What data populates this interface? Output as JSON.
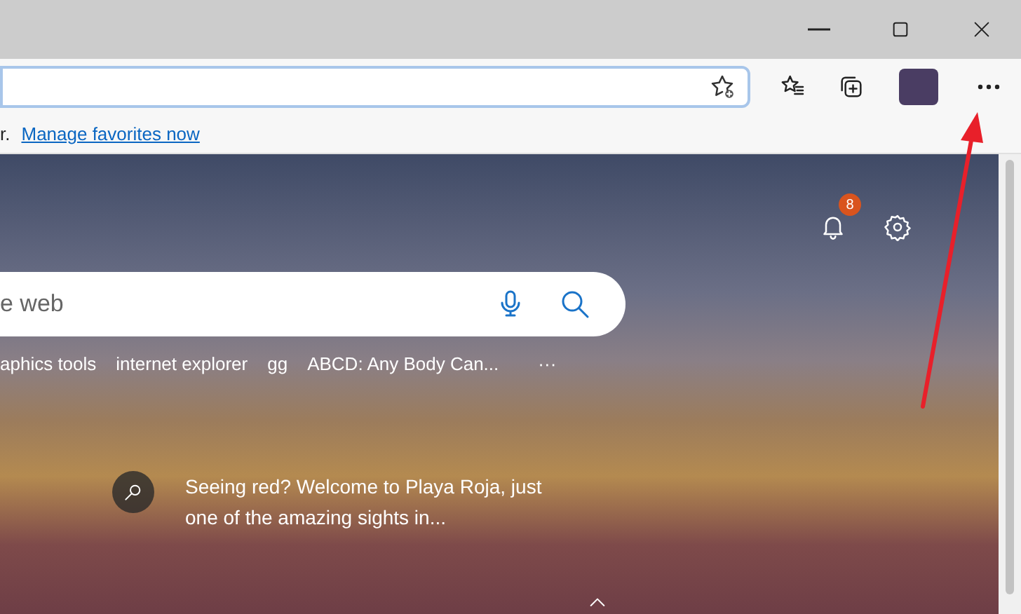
{
  "favorites_bar": {
    "message": "r.",
    "link": "Manage favorites now"
  },
  "new_tab": {
    "notification_count": "8",
    "search": {
      "placeholder": "e web"
    },
    "quick_links": [
      "aphics tools",
      "internet explorer",
      "gg",
      "ABCD: Any Body Can..."
    ],
    "more": "···",
    "caption": "Seeing red? Welcome to Playa Roja, just one of the amazing sights in..."
  }
}
